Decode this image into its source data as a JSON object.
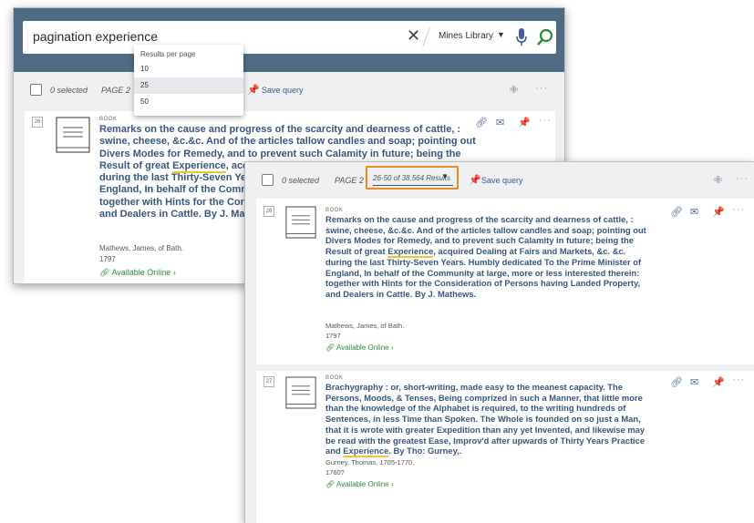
{
  "search": {
    "query": "pagination experience",
    "clear": "✕",
    "scope": "Mines Library",
    "scope_caret": "▼"
  },
  "toolbar": {
    "selected": "0 selected",
    "page": "PAGE 2",
    "save_query": "Save query",
    "result_range": "26-50 of 38,564 Results",
    "result_caret": "▼",
    "pin": "✙",
    "more": "···"
  },
  "results_per_page": {
    "title": "Results per page",
    "options": [
      "10",
      "25",
      "50"
    ],
    "selected": "25"
  },
  "icons": {
    "link": "🔗",
    "email": "✉",
    "pin": "📌"
  },
  "results": [
    {
      "number": "26",
      "type": "BOOK",
      "title_front_lines": [
        "Remarks on the cause and progress of the scarcity and dearness of cattle, :",
        "swine, cheese, &c.&c. And of the articles tallow candles and soap; pointing out",
        "Divers Modes for Remedy, and to prevent such Calamity in future; being the",
        "Result of great",
        "Experience",
        ", acquired Dealing at Fairs and Markets, &c. &c.",
        "during the last Thirty-Seven Years. Humbly dedicated To the Prime Minister of",
        "England, In behalf of the Community at large, more or less interested therein:",
        "together with Hints for the Consideration of Persons having Landed Property,",
        "and Dealers in Cattle. By J. Mathews."
      ],
      "title_back_lines": [
        "Remarks on the cause and progress of the scarcity and dearness of cattle, :",
        "swine, cheese, &c.&c. And of the articles tallow candles and soap; pointing out",
        "Divers Modes for Remedy, and to prevent such Calamity in future; being the",
        "Result of great",
        "Experience",
        ", acqui",
        "during the last Thirty-Seven Year",
        "England, In behalf of the Commu",
        "together with Hints for the Consi",
        "and Dealers in Cattle. By J. Mathe"
      ],
      "author": "Mathews, James, of Bath.",
      "year": "1797",
      "availability": "Available Online"
    },
    {
      "number": "27",
      "type": "BOOK",
      "title_lines": [
        "Brachygraphy : or, short-writing, made easy to the meanest capacity. The",
        "Persons, Moods, & Tenses, Being comprized in such a Manner, that little more",
        "than the knowledge of the Alphabet is required, to the writing hundreds of",
        "Sentences, in less Time than Spoken. The Whole is founded on so just a Man,",
        "that it is wrote with greater Expedition than any yet Invented, and likewise may",
        "be read with the greatest Ease, Improv'd after upwards of Thirty Years Practice",
        "and",
        "Experience",
        ". By Tho: Gurney,."
      ],
      "author": "Gurney, Thomas, 1705-1770.",
      "year": "1760?",
      "availability": "Available Online"
    }
  ],
  "colors": {
    "header": "#4f6a85",
    "title": "#38577d",
    "available": "#2f8a3c",
    "highlight": "#f2c531",
    "range_border": "#f08a24"
  }
}
